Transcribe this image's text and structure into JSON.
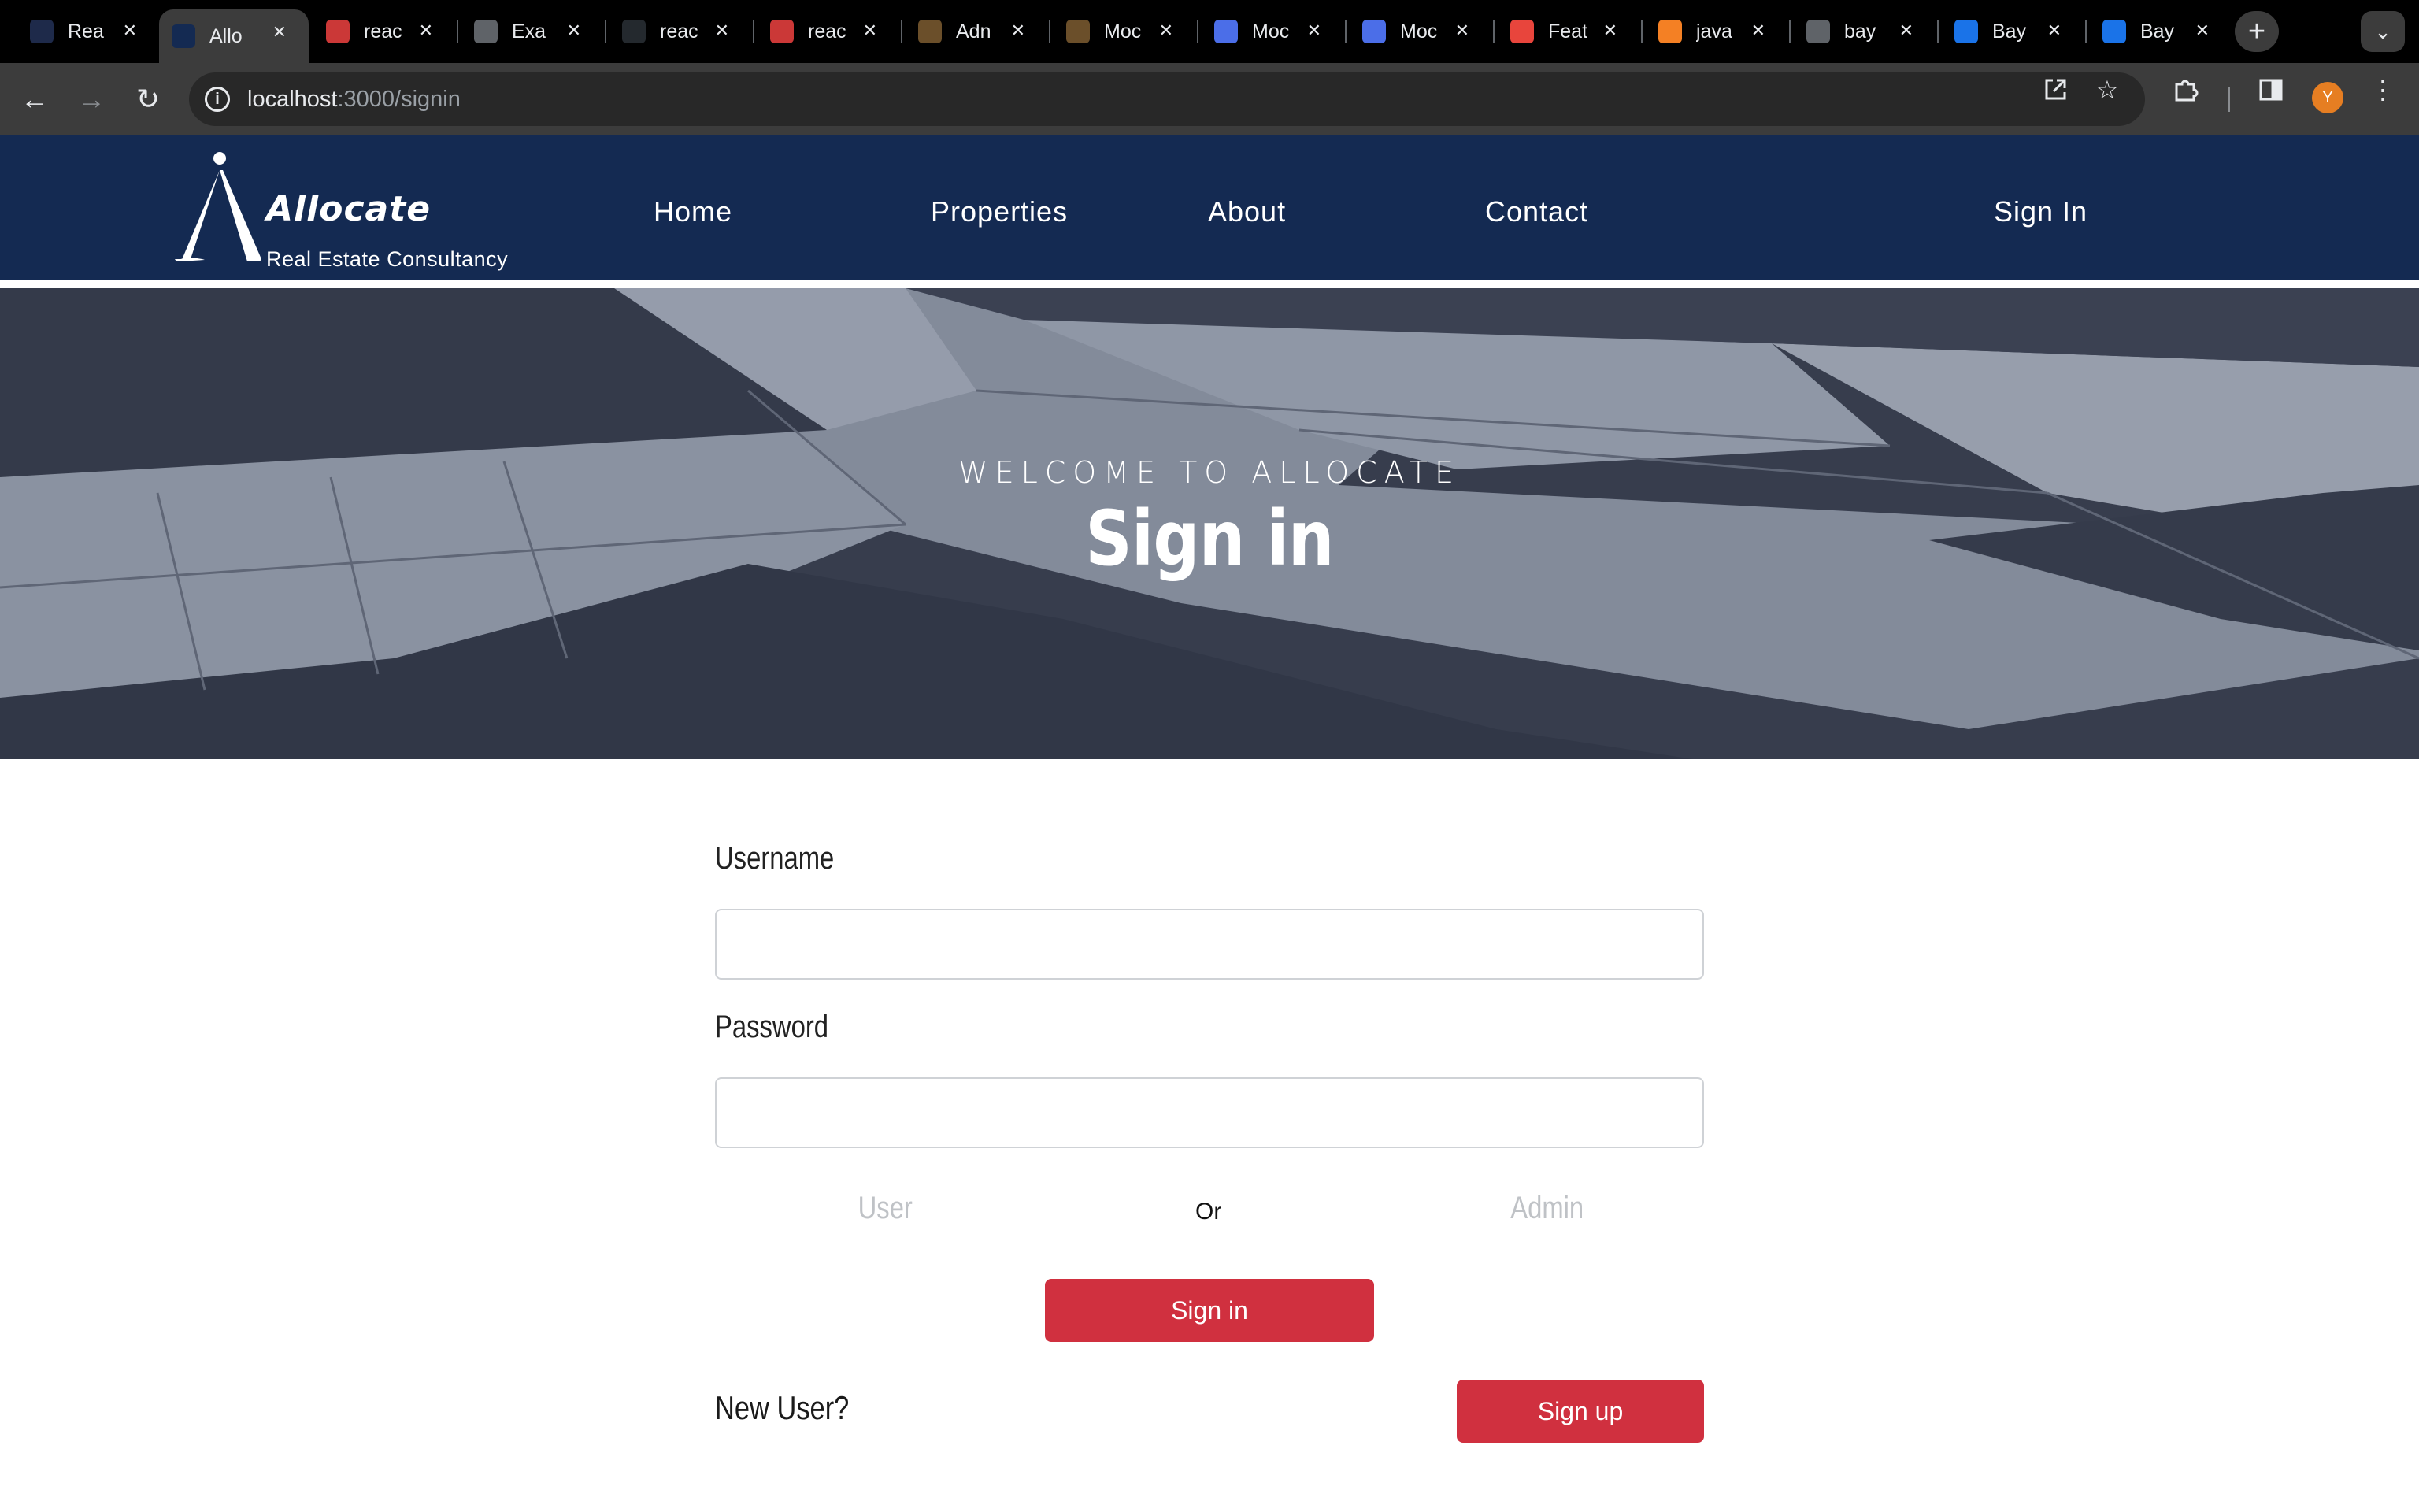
{
  "browser": {
    "tabs": [
      {
        "title": "Rea",
        "icon": "react-icon",
        "color": "#1e2a4a"
      },
      {
        "title": "Allo",
        "icon": "allocate-icon",
        "color": "#142a52",
        "active": true
      },
      {
        "title": "reac",
        "icon": "npm-icon",
        "color": "#cb3837"
      },
      {
        "title": "Exa",
        "icon": "globe-icon",
        "color": "#5f6368"
      },
      {
        "title": "reac",
        "icon": "github-icon",
        "color": "#24292e"
      },
      {
        "title": "reac",
        "icon": "npm-icon",
        "color": "#cb3837"
      },
      {
        "title": "Adn",
        "icon": "book-icon",
        "color": "#6b4f2a"
      },
      {
        "title": "Moc",
        "icon": "book-icon",
        "color": "#6b4f2a"
      },
      {
        "title": "Moc",
        "icon": "blueprint-icon",
        "color": "#4b6ee8"
      },
      {
        "title": "Moc",
        "icon": "blueprint-icon",
        "color": "#4b6ee8"
      },
      {
        "title": "Feat",
        "icon": "chevron-icon",
        "color": "#e8453c"
      },
      {
        "title": "java",
        "icon": "stackoverflow-icon",
        "color": "#f48024"
      },
      {
        "title": "bay",
        "icon": "globe-icon",
        "color": "#5f6368"
      },
      {
        "title": "Bay",
        "icon": "search-q-icon",
        "color": "#1a73e8"
      },
      {
        "title": "Bay",
        "icon": "search-q-icon",
        "color": "#1a73e8"
      }
    ],
    "url_host": "localhost",
    "url_path": ":3000/signin",
    "avatar_letter": "Y"
  },
  "site": {
    "logo_name": "Allocate",
    "logo_tagline": "Real Estate Consultancy",
    "nav": {
      "home": "Home",
      "properties": "Properties",
      "about": "About",
      "contact": "Contact",
      "signin": "Sign In"
    },
    "header_color": "#142a52"
  },
  "hero": {
    "subtitle": "WELCOME TO ALLOCATE",
    "title": "Sign in"
  },
  "form": {
    "username_label": "Username",
    "username_value": "",
    "password_label": "Password",
    "password_value": "",
    "role_user": "User",
    "role_or": "Or",
    "role_admin": "Admin",
    "signin_button": "Sign in",
    "new_user_text": "New User?",
    "signup_button": "Sign up",
    "accent_color": "#d0303f"
  }
}
